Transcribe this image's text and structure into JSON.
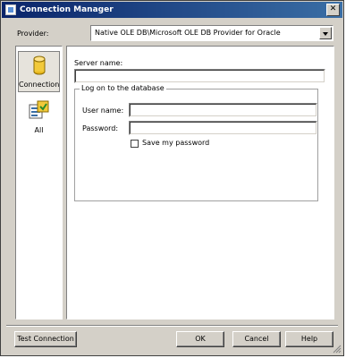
{
  "window": {
    "title": "Connection Manager"
  },
  "provider": {
    "label": "Provider:",
    "selected": "Native OLE DB\\Microsoft OLE DB Provider for Oracle"
  },
  "sidebar": {
    "items": [
      {
        "label": "Connection",
        "icon": "database-cylinder-icon",
        "selected": true
      },
      {
        "label": "All",
        "icon": "properties-list-icon",
        "selected": false
      }
    ]
  },
  "form": {
    "server_name_label": "Server name:",
    "server_name_value": "",
    "logon_group_title": "Log on to the database",
    "user_name_label": "User name:",
    "user_name_value": "",
    "password_label": "Password:",
    "password_value": "",
    "save_password_label": "Save my password",
    "save_password_checked": false
  },
  "buttons": {
    "test_connection": "Test Connection",
    "ok": "OK",
    "cancel": "Cancel",
    "help": "Help"
  },
  "colors": {
    "title_bar_start": "#0a246a",
    "title_bar_end": "#3a6ea5",
    "dialog_face": "#d4d0c8"
  }
}
